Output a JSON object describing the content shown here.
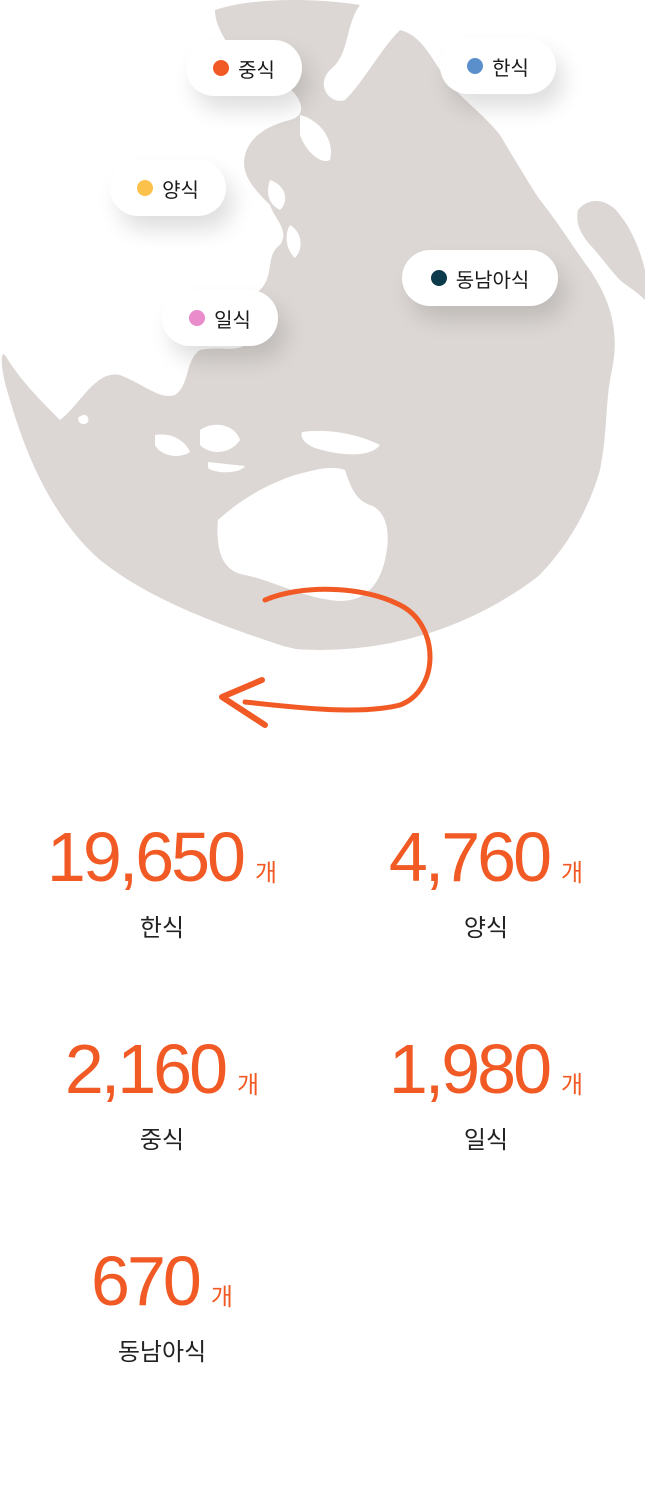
{
  "colors": {
    "accent": "#f15a24",
    "globe": "#dcd7d4",
    "korean": "#5b8fcb",
    "chinese": "#f15a24",
    "western": "#fcc14b",
    "japanese": "#ea8bcb",
    "southeast_asian": "#0b3a4a"
  },
  "map_labels": {
    "chinese": "중식",
    "korean": "한식",
    "western": "양식",
    "southeast_asian": "동남아식",
    "japanese": "일식"
  },
  "stats": {
    "unit": "개",
    "korean": {
      "value": "19,650",
      "label": "한식"
    },
    "western": {
      "value": "4,760",
      "label": "양식"
    },
    "chinese": {
      "value": "2,160",
      "label": "중식"
    },
    "japanese": {
      "value": "1,980",
      "label": "일식"
    },
    "southeast_asian": {
      "value": "670",
      "label": "동남아식"
    }
  }
}
